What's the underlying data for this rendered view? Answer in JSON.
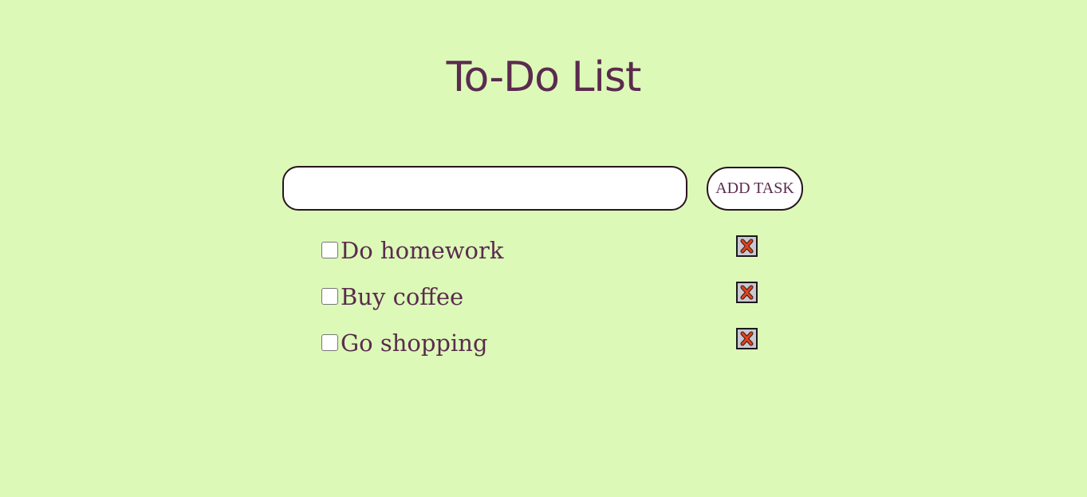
{
  "header": {
    "title": "To-Do List"
  },
  "form": {
    "input_value": "",
    "add_label": "ADD TASK"
  },
  "tasks": [
    {
      "label": "Do homework",
      "checked": false
    },
    {
      "label": "Buy coffee",
      "checked": false
    },
    {
      "label": "Go shopping",
      "checked": false
    }
  ],
  "icons": {
    "delete": "close-icon"
  },
  "colors": {
    "background": "#dcf9b8",
    "text": "#5b2b4e",
    "delete_x": "#e0431b"
  }
}
